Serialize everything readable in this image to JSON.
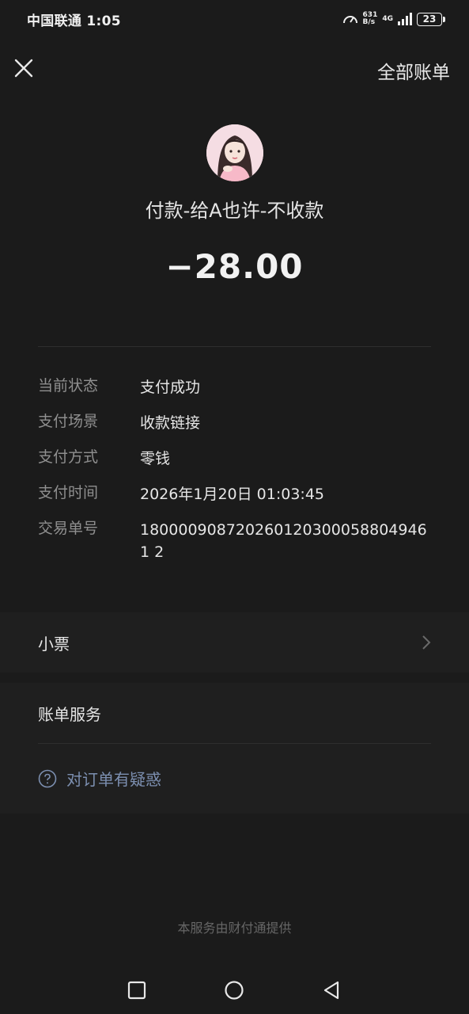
{
  "status_bar": {
    "carrier": "中国联通 1:05",
    "net_speed_value": "631",
    "net_speed_unit": "B/s",
    "network_type": "4G",
    "battery": "23"
  },
  "header": {
    "close_icon": "close-icon",
    "all_bills": "全部账单"
  },
  "transaction": {
    "payee": "付款-给A也许-不收款",
    "amount": "−28.00"
  },
  "details": [
    {
      "label": "当前状态",
      "value": "支付成功"
    },
    {
      "label": "支付场景",
      "value": "收款链接"
    },
    {
      "label": "支付方式",
      "value": "零钱"
    },
    {
      "label": "支付时间",
      "value": "2026年1月20日 01:03:45"
    },
    {
      "label": "交易单号",
      "value": "1800009087202601203000588049461 2"
    }
  ],
  "receipt": {
    "label": "小票"
  },
  "services": {
    "title": "账单服务",
    "doubt": "对订单有疑惑"
  },
  "footer": "本服务由财付通提供",
  "colors": {
    "background": "#1b1b1b",
    "link_blue": "#7c8fb0",
    "label_gray": "#8f8f8f"
  }
}
